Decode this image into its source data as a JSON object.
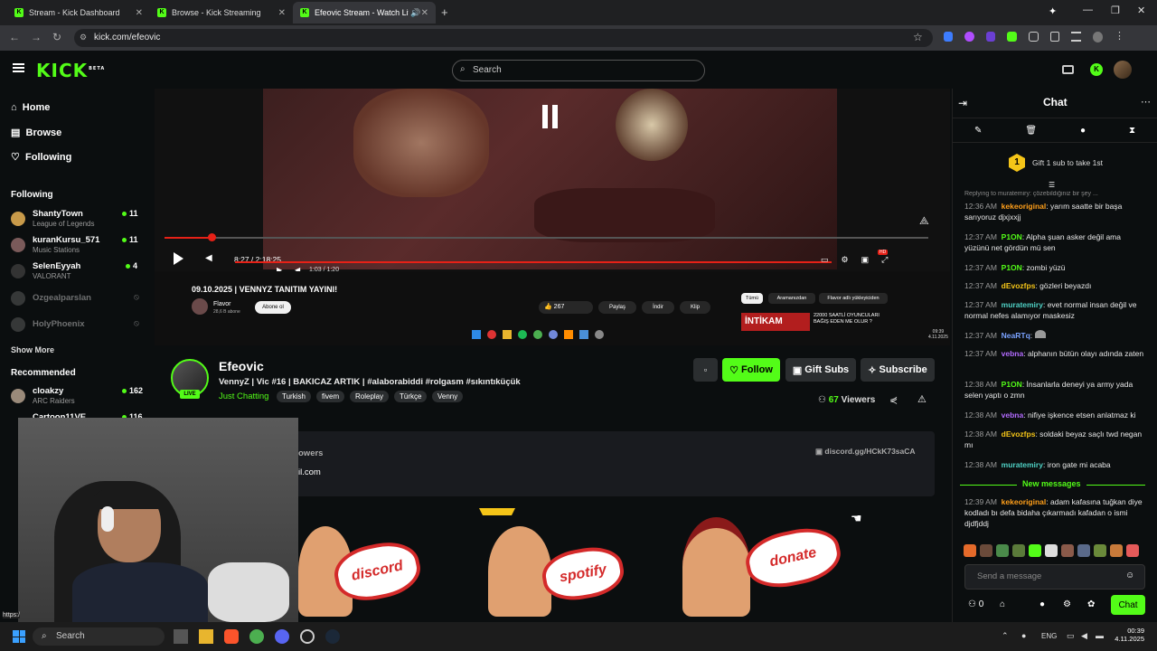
{
  "browser": {
    "tabs": [
      {
        "label": "Stream - Kick Dashboard"
      },
      {
        "label": "Browse - Kick Streaming"
      },
      {
        "label": "Efeovic Stream - Watch Live"
      }
    ],
    "url": "kick.com/efeovic"
  },
  "header": {
    "logo": "KICK",
    "beta": "BETA",
    "search_placeholder": "Search"
  },
  "sidebar": {
    "nav": [
      {
        "label": "Home",
        "icon": "home-icon"
      },
      {
        "label": "Browse",
        "icon": "browse-icon"
      },
      {
        "label": "Following",
        "icon": "heart-icon"
      }
    ],
    "following_title": "Following",
    "following": [
      {
        "name": "ShantyTown",
        "sub": "League of Legends",
        "count": "11"
      },
      {
        "name": "kuranKursu_571",
        "sub": "Music Stations",
        "count": "11"
      },
      {
        "name": "SelenEyyah",
        "sub": "VALORANT",
        "count": "4"
      },
      {
        "name": "Ozgealparslan",
        "sub": "",
        "count": ""
      },
      {
        "name": "HolyPhoenix",
        "sub": "",
        "count": ""
      }
    ],
    "show_more": "Show More",
    "recommended_title": "Recommended",
    "recommended": [
      {
        "name": "cloakzy",
        "sub": "ARC Raiders",
        "count": "162"
      },
      {
        "name": "Cartoon11VE",
        "sub": "",
        "count": "116"
      }
    ]
  },
  "player": {
    "inner_time": "8:27 / 2:18:25",
    "inner_time2": "1:03 / 1:20",
    "inner_title": "09.10.2025 | VENNYZ TANITIM YAYINI!",
    "inner_channel": "Flavor",
    "inner_subs": "28,6 B abone",
    "inner_subscribe": "Abone ol",
    "inner_likes": "267",
    "inner_share": "Paylaş",
    "inner_download": "İndir",
    "inner_clip": "Klip",
    "chips": [
      "Tümü",
      "Aramanızdan",
      "Flavor adlı yükleyiciden"
    ],
    "thumb_title": "İNTİKAM",
    "thumb_text": "22000 SAATLİ OYUNCULARI BAĞIŞ EDEN ME OLUR ?",
    "clock_time": "09:39",
    "clock_date": "4.11.2025"
  },
  "stream": {
    "name": "Efeovic",
    "live": "LIVE",
    "title": "VennyZ | Vic #16 | BAKICAZ ARTIK | #alaborabiddi #rolgasm #sıkıntıküçük",
    "category": "Just Chatting",
    "tags": [
      "Turkish",
      "fivem",
      "Roleplay",
      "Türkçe",
      "Venny"
    ],
    "follow": "Follow",
    "gift": "Gift Subs",
    "subscribe": "Subscribe",
    "viewers_count": "67",
    "viewers_label": "Viewers",
    "about_followers": "owers",
    "about_email": "il.com",
    "discord": "discord.gg/HCkK73saCA"
  },
  "stickers": [
    "discord",
    "spotify",
    "donate"
  ],
  "chat": {
    "title": "Chat",
    "gift_text": "Gift 1 sub to take 1st",
    "gift_rank": "1",
    "reply_hint": "Replying to muratemiry: çözebildiğiniz bir şey ...",
    "messages": [
      {
        "time": "12:36 AM",
        "user": "kekeoriginal",
        "color": "#ff9f1a",
        "text": "yarım saatte bir başa sarıyoruz djxjxxjj"
      },
      {
        "time": "12:37 AM",
        "user": "P1ON",
        "color": "#53fc18",
        "text": "Alpha şuan asker değil ama yüzünü net gördün mü sen"
      },
      {
        "time": "12:37 AM",
        "user": "P1ON",
        "color": "#53fc18",
        "text": "zombi yüzü"
      },
      {
        "time": "12:37 AM",
        "user": "dEvozfps",
        "color": "#f5c518",
        "text": "gözleri beyazdı"
      },
      {
        "time": "12:37 AM",
        "user": "muratemiry",
        "color": "#4fd1c5",
        "text": "evet normal insan değil ve normal nefes alamıyor maskesiz"
      },
      {
        "time": "12:37 AM",
        "user": "NeaRTq",
        "color": "#7aa2ff",
        "text": ""
      },
      {
        "time": "12:37 AM",
        "user": "vebna",
        "color": "#b36bff",
        "text": "alphanın bütün olayı adında zaten"
      },
      {
        "time": "12:38 AM",
        "user": "P1ON",
        "color": "#53fc18",
        "text": "İnsanlarla deneyi ya army yada selen yaptı o zmn"
      },
      {
        "time": "12:38 AM",
        "user": "vebna",
        "color": "#b36bff",
        "text": "nifiye işkence etsen anlatmaz ki"
      },
      {
        "time": "12:38 AM",
        "user": "dEvozfps",
        "color": "#f5c518",
        "text": "soldaki beyaz saçlı twd negan mı"
      },
      {
        "time": "12:38 AM",
        "user": "muratemiry",
        "color": "#4fd1c5",
        "text": "iron gate mi acaba"
      }
    ],
    "new_messages": "New messages",
    "new": [
      {
        "time": "12:39 AM",
        "user": "kekeoriginal",
        "color": "#ff9f1a",
        "text": "adam kafasına tuğkan diye kodladı bı defa bidaha çıkarmadı kafadan o ismi djdfjddj"
      }
    ],
    "input_placeholder": "Send a message",
    "user_count": "0",
    "send": "Chat"
  },
  "taskbar": {
    "search": "Search",
    "lang": "ENG",
    "time": "00:39",
    "date": "4.11.2025",
    "status_url": "https:/"
  }
}
